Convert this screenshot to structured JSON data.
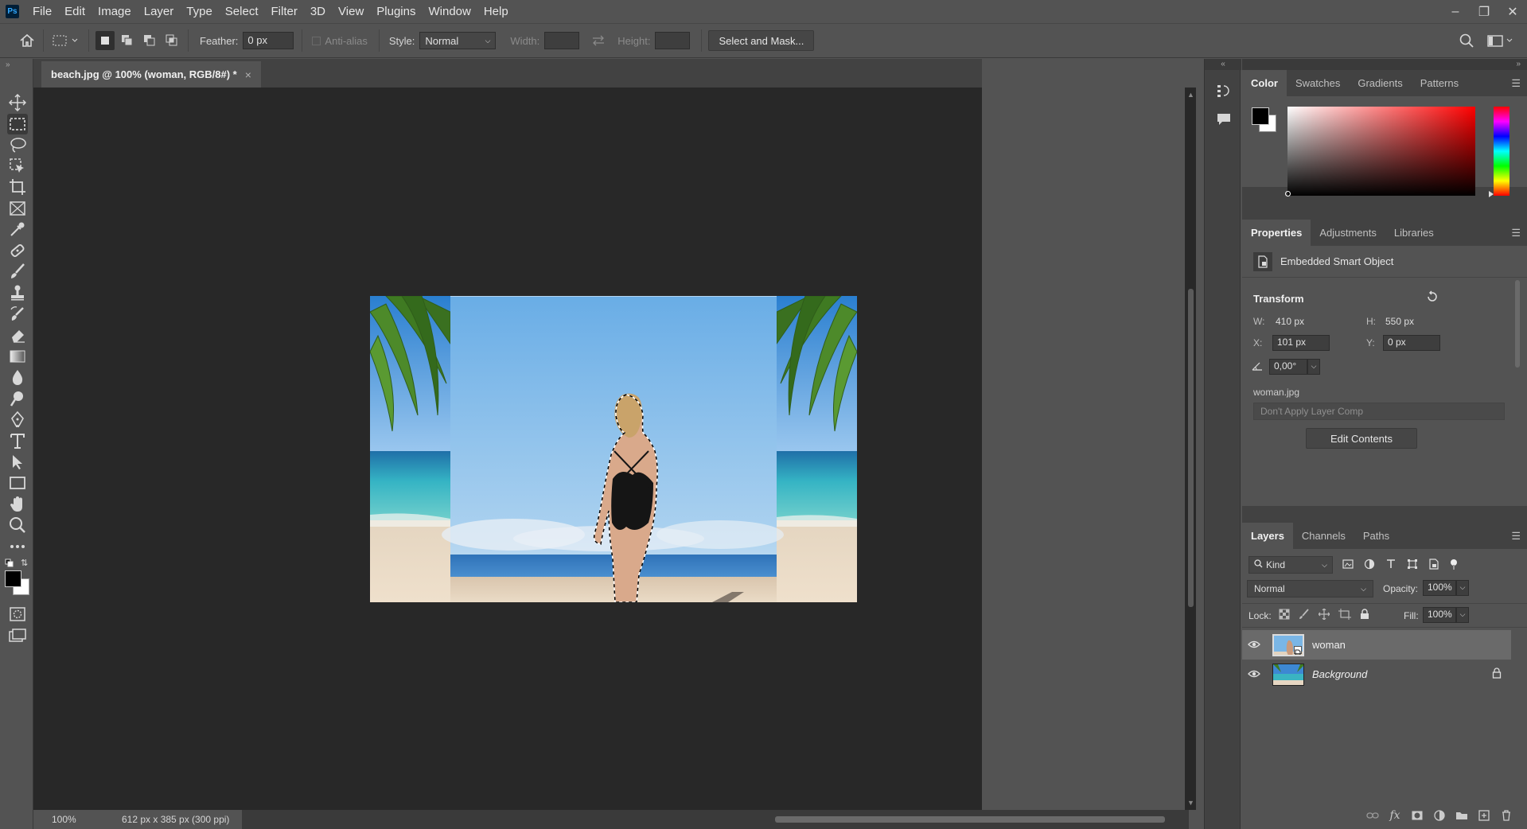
{
  "app": {
    "logo": "Ps"
  },
  "menu": [
    "File",
    "Edit",
    "Image",
    "Layer",
    "Type",
    "Select",
    "Filter",
    "3D",
    "View",
    "Plugins",
    "Window",
    "Help"
  ],
  "window_controls": {
    "minimize": "–",
    "restore": "❐",
    "close": "✕"
  },
  "options": {
    "feather_label": "Feather:",
    "feather_value": "0 px",
    "antialias_label": "Anti-alias",
    "style_label": "Style:",
    "style_value": "Normal",
    "width_label": "Width:",
    "height_label": "Height:",
    "select_mask_label": "Select and Mask..."
  },
  "document": {
    "tab_title": "beach.jpg @ 100% (woman, RGB/8#) *",
    "close": "×"
  },
  "status": {
    "zoom": "100%",
    "doc_info": "612 px x 385 px (300 ppi)",
    "arrow": "❯"
  },
  "color_panel": {
    "tabs": [
      "Color",
      "Swatches",
      "Gradients",
      "Patterns"
    ],
    "active_tab": "Color"
  },
  "properties_panel": {
    "tabs": [
      "Properties",
      "Adjustments",
      "Libraries"
    ],
    "object_type": "Embedded Smart Object",
    "transform_label": "Transform",
    "w_label": "W:",
    "w_value": "410 px",
    "h_label": "H:",
    "h_value": "550 px",
    "x_label": "X:",
    "x_value": "101 px",
    "y_label": "Y:",
    "y_value": "0 px",
    "angle_value": "0,00°",
    "filename": "woman.jpg",
    "layer_comp_placeholder": "Don't Apply Layer Comp",
    "edit_contents": "Edit Contents"
  },
  "layers_panel": {
    "tabs": [
      "Layers",
      "Channels",
      "Paths"
    ],
    "filter_kind": "Kind",
    "blend_mode": "Normal",
    "opacity_label": "Opacity:",
    "opacity_value": "100%",
    "lock_label": "Lock:",
    "fill_label": "Fill:",
    "fill_value": "100%",
    "layers": [
      {
        "name": "woman",
        "selected": true,
        "locked": false
      },
      {
        "name": "Background",
        "selected": false,
        "locked": true
      }
    ]
  },
  "colors": {
    "foreground": "#000000",
    "background": "#ffffff",
    "picker_hue": "#ff0000"
  }
}
